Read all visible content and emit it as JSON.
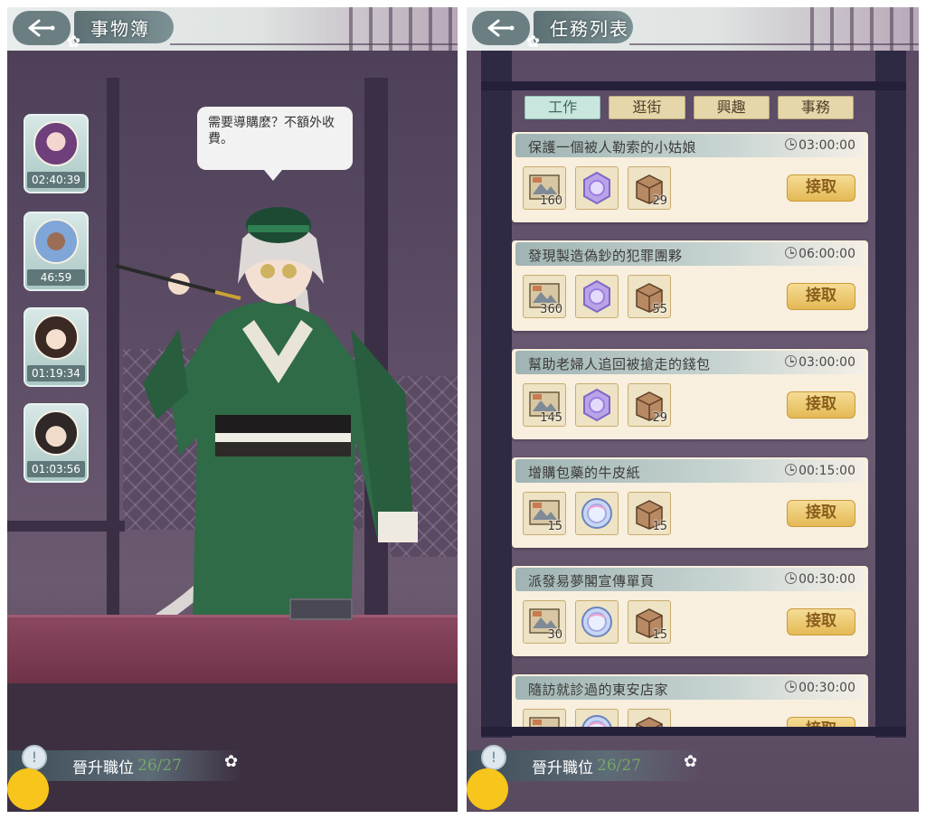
{
  "left_panel": {
    "title": "事物簿",
    "speech": "需要導購麼？不額外收費。",
    "avatars": [
      {
        "timer": "02:40:39",
        "icon": "character-portrait-purple-hair"
      },
      {
        "timer": "46:59",
        "icon": "character-portrait-blue-hair"
      },
      {
        "timer": "01:19:34",
        "icon": "character-portrait-glasses"
      },
      {
        "timer": "01:03:56",
        "icon": "character-portrait-dark-hair"
      }
    ],
    "promotion": {
      "label": "晉升職位",
      "count": "26/27"
    }
  },
  "right_panel": {
    "title": "任務列表",
    "tabs": [
      {
        "label": "工作",
        "active": true
      },
      {
        "label": "逛街",
        "active": false
      },
      {
        "label": "興趣",
        "active": false
      },
      {
        "label": "事務",
        "active": false
      }
    ],
    "tasks": [
      {
        "title": "保護一個被人勒索的小姑娘",
        "time": "03:00:00",
        "rewards": [
          "160",
          "",
          "29"
        ],
        "crystal": "purple",
        "accept": "接取"
      },
      {
        "title": "發現製造偽鈔的犯罪團夥",
        "time": "06:00:00",
        "rewards": [
          "360",
          "",
          "55"
        ],
        "crystal": "purple",
        "accept": "接取"
      },
      {
        "title": "幫助老婦人追回被搶走的錢包",
        "time": "03:00:00",
        "rewards": [
          "145",
          "",
          "29"
        ],
        "crystal": "purple",
        "accept": "接取"
      },
      {
        "title": "增購包藥的牛皮紙",
        "time": "00:15:00",
        "rewards": [
          "15",
          "",
          "15"
        ],
        "crystal": "blue",
        "accept": "接取"
      },
      {
        "title": "派發易夢閣宣傳單頁",
        "time": "00:30:00",
        "rewards": [
          "30",
          "",
          "15"
        ],
        "crystal": "blue",
        "accept": "接取"
      },
      {
        "title": "隨訪就診過的東安店家",
        "time": "00:30:00",
        "rewards": [
          "",
          "",
          ""
        ],
        "crystal": "blue",
        "accept": "接取"
      }
    ],
    "promotion": {
      "label": "晉升職位",
      "count": "26/27"
    }
  },
  "colors": {
    "accent_yellow": "#f7c51b",
    "header_teal": "#6b7f82",
    "accept_gold": "#e4b954",
    "progress_green": "#74a66a"
  }
}
